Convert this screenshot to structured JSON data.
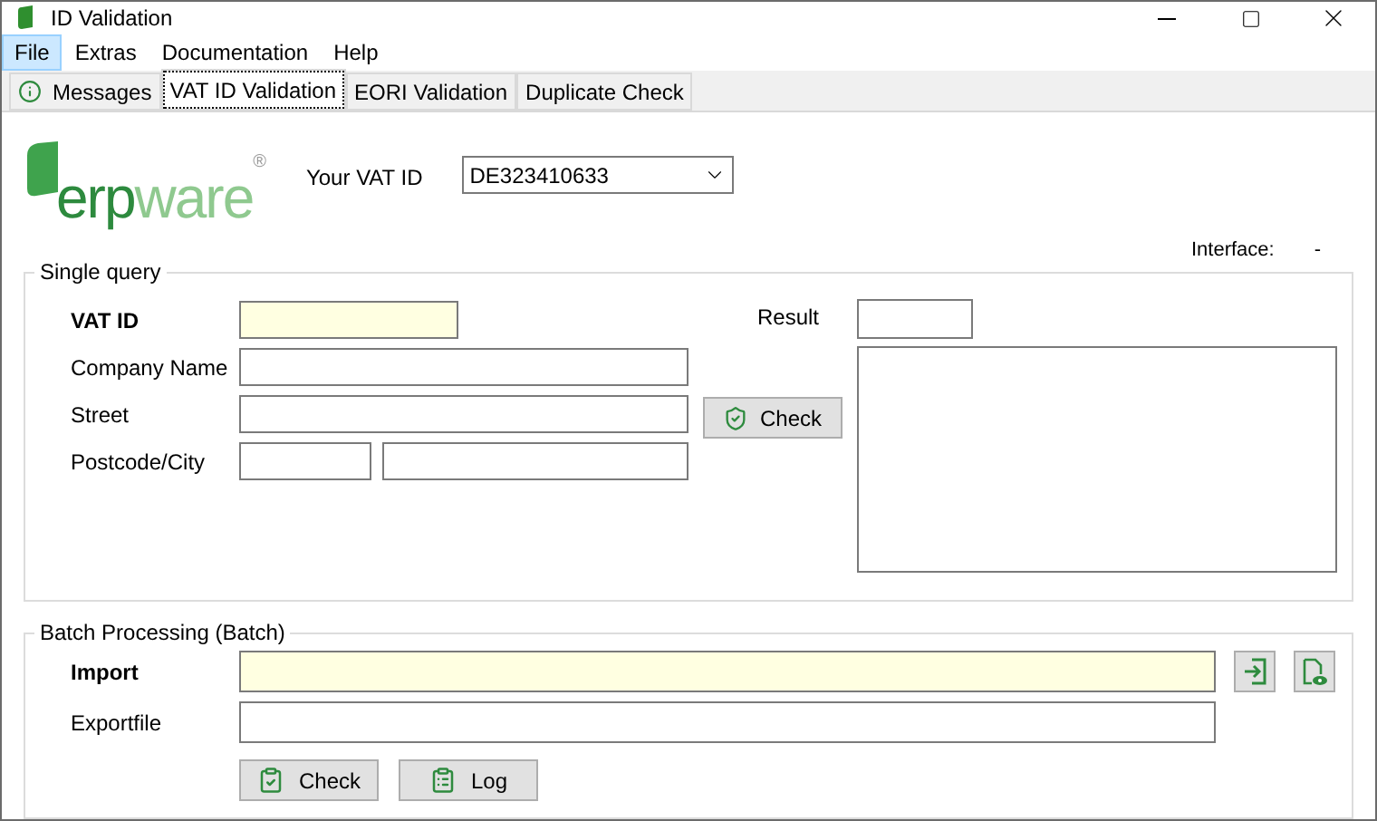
{
  "window": {
    "title": "ID Validation"
  },
  "menu": [
    {
      "label": "File",
      "selected": true
    },
    {
      "label": "Extras",
      "selected": false
    },
    {
      "label": "Documentation",
      "selected": false
    },
    {
      "label": "Help",
      "selected": false
    }
  ],
  "tabs": [
    {
      "label": "Messages",
      "kind": "info",
      "selected": false
    },
    {
      "label": "VAT ID Validation",
      "selected": true
    },
    {
      "label": "EORI Validation",
      "selected": false
    },
    {
      "label": "Duplicate Check",
      "selected": false
    }
  ],
  "logo": {
    "part_1": "erp",
    "part_2": "ware",
    "mark": "®"
  },
  "your_vat_id": {
    "label": "Your VAT ID",
    "value": "DE323410633"
  },
  "interface": {
    "label": "Interface:",
    "value": "-"
  },
  "single_query": {
    "title": "Single query",
    "fields": [
      {
        "label": "VAT ID",
        "required": true,
        "kind": "short"
      },
      {
        "label": "Company Name",
        "required": false,
        "kind": "wide"
      },
      {
        "label": "Street",
        "required": false,
        "kind": "wide"
      },
      {
        "label": "Postcode/City",
        "required": false,
        "kind": "split"
      }
    ],
    "check_button": {
      "label": "Check"
    },
    "result": {
      "label": "Result"
    }
  },
  "batch": {
    "title": "Batch Processing (Batch)",
    "fields": [
      {
        "label": "Import",
        "required": true,
        "kind": "file"
      },
      {
        "label": "Exportfile",
        "required": false,
        "kind": "plain"
      }
    ],
    "buttons": [
      {
        "label": "Check",
        "kind": "checklist"
      },
      {
        "label": "Log",
        "kind": "list"
      }
    ]
  }
}
